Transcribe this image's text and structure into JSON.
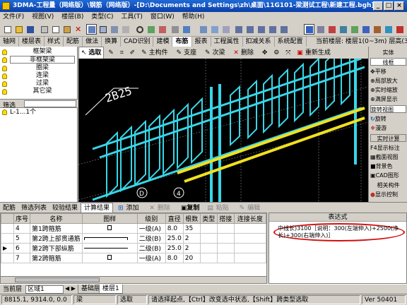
{
  "window": {
    "title": "3DMA-工程量（网络版）\\钢筋（网络版）-[D:\\Documents and Settings\\zh\\桌面\\11G101-梁测试工程\\新建工程.bgh]"
  },
  "menu": [
    "文件(F)",
    "视图(V)",
    "楼层(B)",
    "类型(C)",
    "工具(T)",
    "窗口(W)",
    "帮助(H)"
  ],
  "tabs": [
    "轴网",
    "楼层表",
    "样式",
    "配筋",
    "做法",
    "换算",
    "CAD识别",
    "建模",
    "布筋",
    "报表",
    "工程属性",
    "扣减关系",
    "系统配置"
  ],
  "active_tab": "布筋",
  "floor": {
    "current_label": "当前楼层:",
    "value": "楼层1(0~3m)",
    "height": "层高(3m)"
  },
  "tree": {
    "items": [
      "框架梁",
      "非框架梁",
      "圈梁",
      "连梁",
      "过梁",
      "其它梁"
    ],
    "selected": "非框架梁",
    "filter_label": "筛选",
    "filter_value": "",
    "list_item": "L-1...1个"
  },
  "view_tools": [
    "选取",
    "主构件",
    "支座",
    "次梁",
    "删除",
    "重新生成"
  ],
  "viewport": {
    "label_beam": "2B25",
    "axis_d": "D",
    "axis_4": "4"
  },
  "right_panel": {
    "title": "实体",
    "items": [
      "线框",
      "平移",
      "局部放大",
      "实时缩放",
      "满屏显示",
      "旋转视图",
      "旋转",
      "漫游",
      "实时计算",
      "显示标注",
      "截面视图",
      "背景色",
      "CAD图形",
      "相关构件",
      "显示控制"
    ]
  },
  "bottom_tabs": [
    "配筋",
    "筛选列表",
    "较验结果",
    "计算结果"
  ],
  "active_bottom_tab": "计算结果",
  "grid_tools": [
    "添加",
    "删除",
    "复制",
    "粘贴",
    "编辑"
  ],
  "table": {
    "columns": [
      "序号",
      "名称",
      "图样",
      "级别",
      "直径",
      "根数",
      "类型",
      "搭接",
      "连接长度"
    ],
    "rows": [
      {
        "no": "4",
        "name": "第1跨箍筋",
        "level": "一级(A)",
        "dia": "8.0",
        "count": "35"
      },
      {
        "no": "5",
        "name": "第2跨上部贯通筋",
        "level": "二级(B)",
        "dia": "25.0",
        "count": "2"
      },
      {
        "no": "6",
        "name": "第2跨下部纵筋",
        "level": "二级(B)",
        "dia": "25.0",
        "count": "2"
      },
      {
        "no": "7",
        "name": "第2跨箍筋",
        "level": "一级(A)",
        "dia": "8.0",
        "count": "20"
      }
    ]
  },
  "expression": {
    "header": "表达式",
    "text": "中线长)3100［说明：300(左端伸入)+2500(净长)+300(右端伸入)］"
  },
  "status1": {
    "current_floor_label": "当前层",
    "zone_label": "区域1",
    "sheet_tabs": [
      "基础层",
      "楼层1"
    ],
    "active_sheet": "楼层1"
  },
  "status2": {
    "coords": "8815.1, 9314.0, 0.0",
    "type": "梁",
    "mode": "选取",
    "hint": "请选择起点,【Ctrl】改变选中状态,【Shift】跨类型选取",
    "version": "Ver 50401"
  }
}
